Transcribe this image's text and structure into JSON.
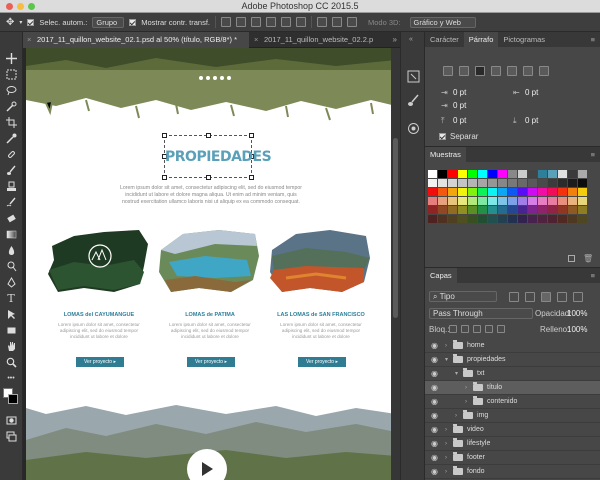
{
  "window": {
    "title": "Adobe Photoshop CC 2015.5"
  },
  "options_bar": {
    "auto_select_label": "Selec. autom.:",
    "auto_select_value": "Grupo",
    "show_transform_label": "Mostrar contr. transf.",
    "mode3d_label": "Modo 3D:",
    "workspace_value": "Gráfico y Web"
  },
  "doc_tabs": [
    {
      "label": "2017_11_quillon_website_02.1.psd al 50% (título, RGB/8*) *"
    },
    {
      "label": "2017_11_quillon_website_02.2.p"
    }
  ],
  "document": {
    "heading": "PROPIEDADES",
    "intro": "Lorem ipsum dolor sit amet, consectetur adipiscing elit, sed do eiusmod tempor incididunt ut labore et dolore magna aliqua. Ut enim ad minim veniam, quis nostrud exercitation ullamco laboris nisi ut aliquip ex ea commodo consequat.",
    "cards": [
      {
        "title": "LOMAS del CAYUMANGUE",
        "text": "Lorem ipsum dolor sit amet, consectetur adipiscing elit, sed do eiusmod tempor incididunt ut labore et dolore",
        "button": "Ver proyecto ▸"
      },
      {
        "title": "LOMAS de PATIMA",
        "text": "Lorem ipsum dolor sit amet, consectetur adipiscing elit, sed do eiusmod tempor incididunt ut labore et dolore",
        "button": "Ver proyecto ▸"
      },
      {
        "title": "LAS LOMAS de SAN FRANCISCO",
        "text": "Lorem ipsum dolor sit amet, consectetur adipiscing elit, sed do eiusmod tempor incididunt ut labore et dolore",
        "button": "Ver proyecto ▸"
      }
    ]
  },
  "paragraph_panel": {
    "tabs": [
      "Carácter",
      "Párrafo",
      "Pictogramas"
    ],
    "active_tab": "Párrafo",
    "fields": {
      "left_indent": "0 pt",
      "right_indent": "0 pt",
      "first_line": "0 pt",
      "space_before": "0 pt",
      "space_after": "0 pt"
    },
    "hyphenate_label": "Separar"
  },
  "swatches_panel": {
    "title": "Muestras"
  },
  "layers_panel": {
    "title": "Capas",
    "filter": "Tipo",
    "blend_mode": "Pass Through",
    "opacity_label": "Opacidad:",
    "opacity_value": "100%",
    "lock_label": "Bloq.:",
    "fill_label": "Relleno:",
    "fill_value": "100%",
    "layers": [
      {
        "name": "home",
        "level": 0,
        "selected": false
      },
      {
        "name": "propiedades",
        "level": 0,
        "selected": false
      },
      {
        "name": "txt",
        "level": 1,
        "selected": false
      },
      {
        "name": "título",
        "level": 2,
        "selected": true
      },
      {
        "name": "contenido",
        "level": 2,
        "selected": false
      },
      {
        "name": "img",
        "level": 1,
        "selected": false
      },
      {
        "name": "video",
        "level": 0,
        "selected": false
      },
      {
        "name": "lifestyle",
        "level": 0,
        "selected": false
      },
      {
        "name": "footer",
        "level": 0,
        "selected": false
      },
      {
        "name": "fondo",
        "level": 0,
        "selected": false
      }
    ]
  },
  "colors": {
    "heading": "#5aa0b8",
    "card_title": "#2d7f9a",
    "button_bg": "#2f7c93"
  },
  "icons": {
    "move": "move-icon",
    "play": "play-icon",
    "eye": "eye-icon",
    "folder": "folder-icon"
  }
}
